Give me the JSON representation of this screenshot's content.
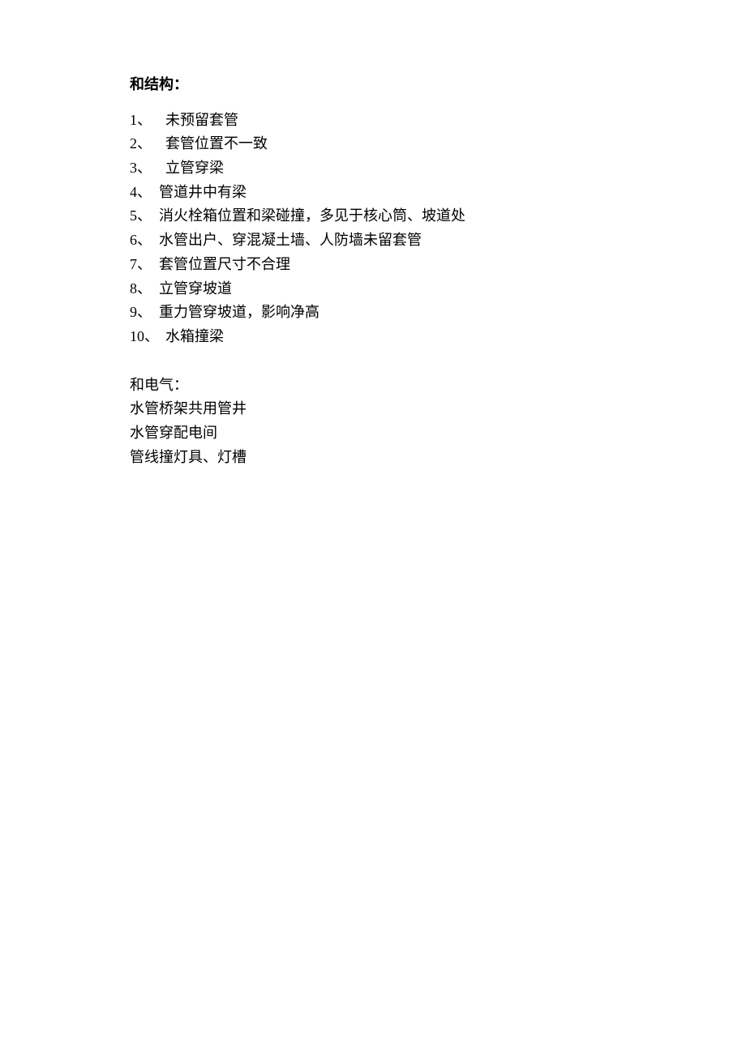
{
  "section1": {
    "heading": "和结构：",
    "items": [
      {
        "num": "1、",
        "text": "未预留套管",
        "indent": true
      },
      {
        "num": "2、",
        "text": "套管位置不一致",
        "indent": true
      },
      {
        "num": "3、",
        "text": "立管穿梁",
        "indent": true
      },
      {
        "num": "4、",
        "text": "管道井中有梁",
        "indent": false
      },
      {
        "num": "5、",
        "text": "消火栓箱位置和梁碰撞，多见于核心筒、坡道处",
        "indent": false
      },
      {
        "num": "6、",
        "text": "水管出户、穿混凝土墙、人防墙未留套管",
        "indent": false
      },
      {
        "num": "7、",
        "text": "套管位置尺寸不合理",
        "indent": false
      },
      {
        "num": "8、",
        "text": "立管穿坡道",
        "indent": false
      },
      {
        "num": "9、",
        "text": "重力管穿坡道，影响净高",
        "indent": false
      },
      {
        "num": "10、",
        "text": "水箱撞梁",
        "indent": false
      }
    ]
  },
  "section2": {
    "heading": "和电气：",
    "lines": [
      "水管桥架共用管井",
      "水管穿配电间",
      "管线撞灯具、灯槽"
    ]
  }
}
